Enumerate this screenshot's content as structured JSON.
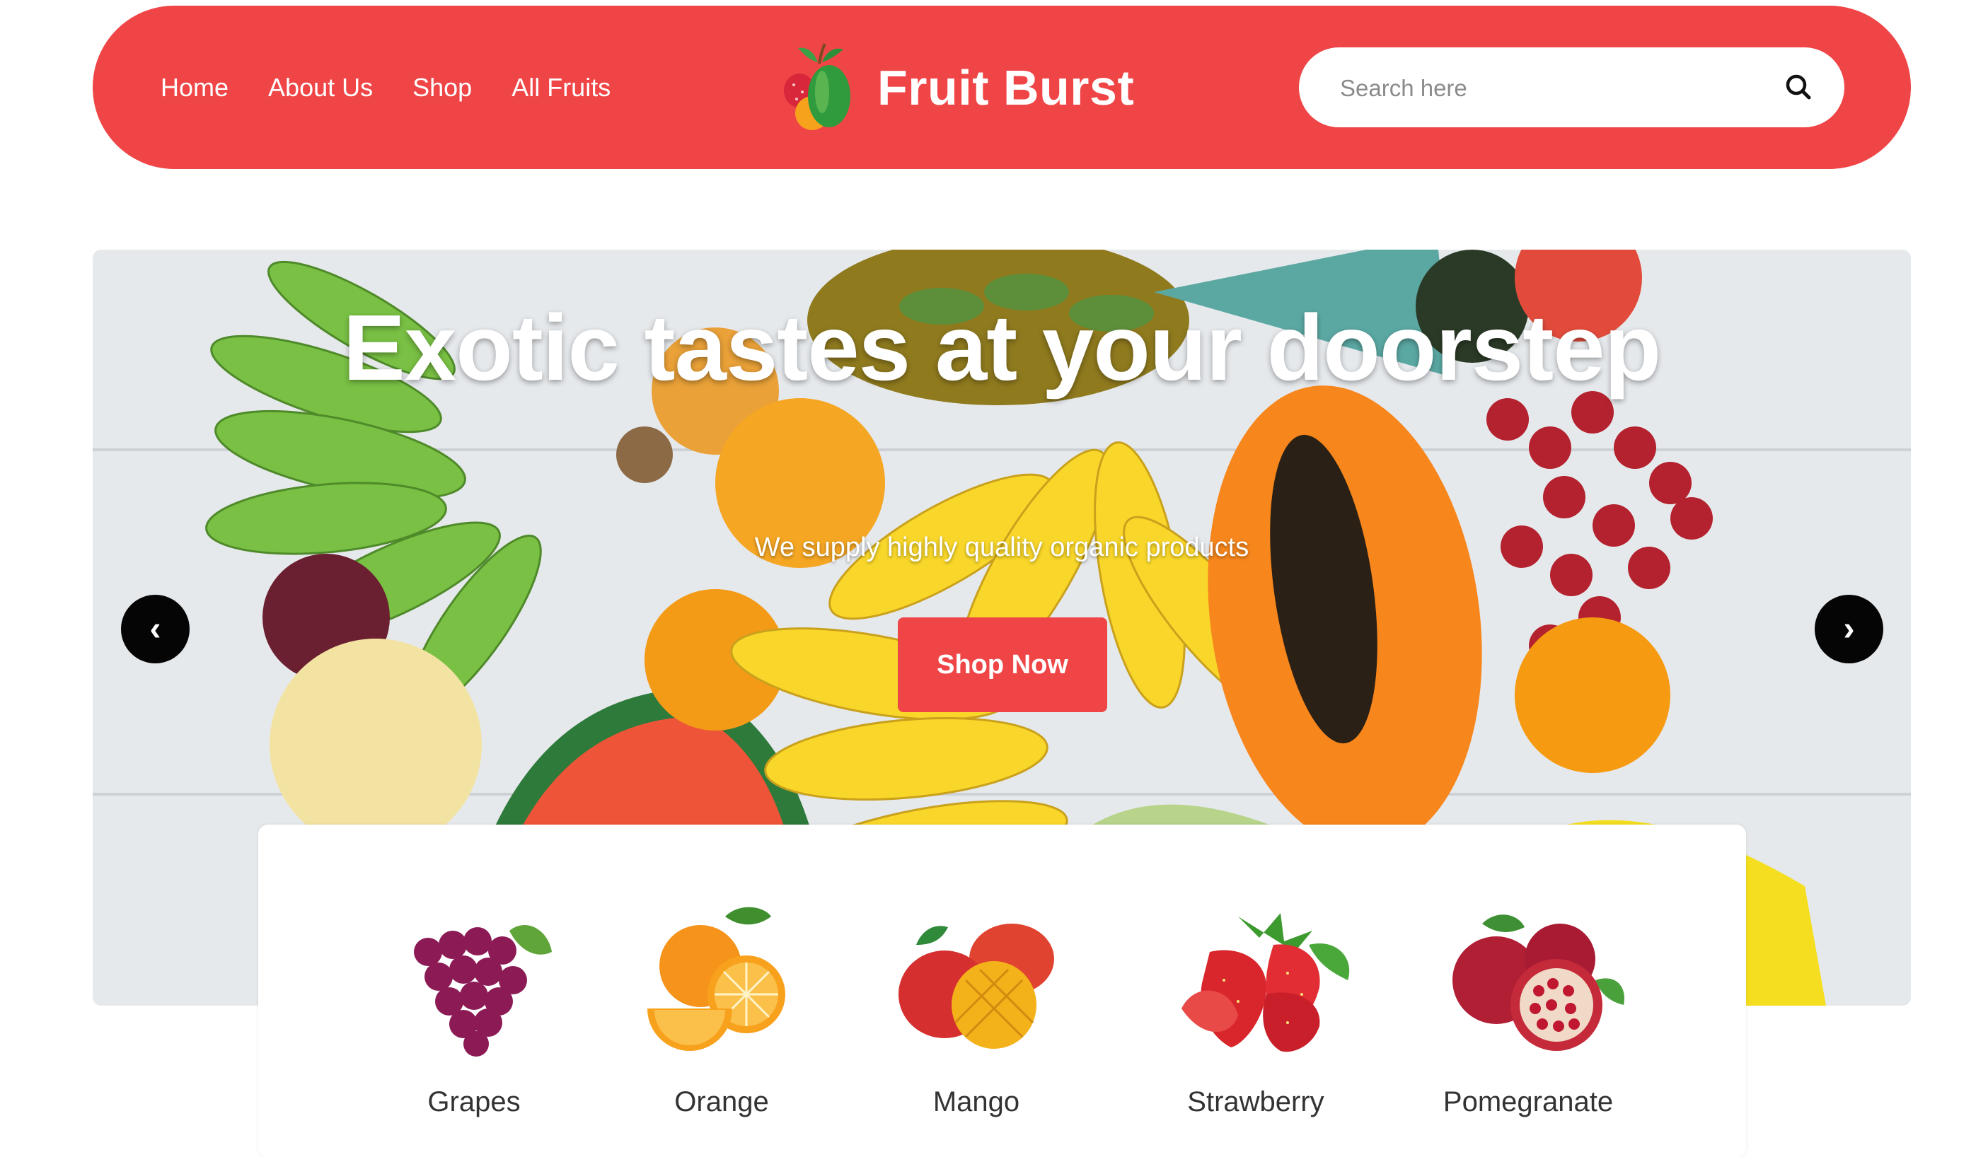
{
  "header": {
    "nav": [
      "Home",
      "About Us",
      "Shop",
      "All Fruits"
    ],
    "brand": "Fruit Burst",
    "search_placeholder": "Search here"
  },
  "hero": {
    "title": "Exotic tastes at your doorstep",
    "subtitle": "We supply highly quality organic products",
    "button": "Shop Now",
    "prev_icon": "‹",
    "next_icon": "›"
  },
  "categories": [
    "Grapes",
    "Orange",
    "Mango",
    "Strawberry",
    "Pomegranate"
  ],
  "colors": {
    "accent": "#ef4546",
    "arrow_bg": "#050505",
    "text_dark": "#333333"
  },
  "icons": {
    "logo": "fruit-logo-icon",
    "search": "search-icon",
    "prev": "chevron-left-icon",
    "next": "chevron-right-icon"
  }
}
